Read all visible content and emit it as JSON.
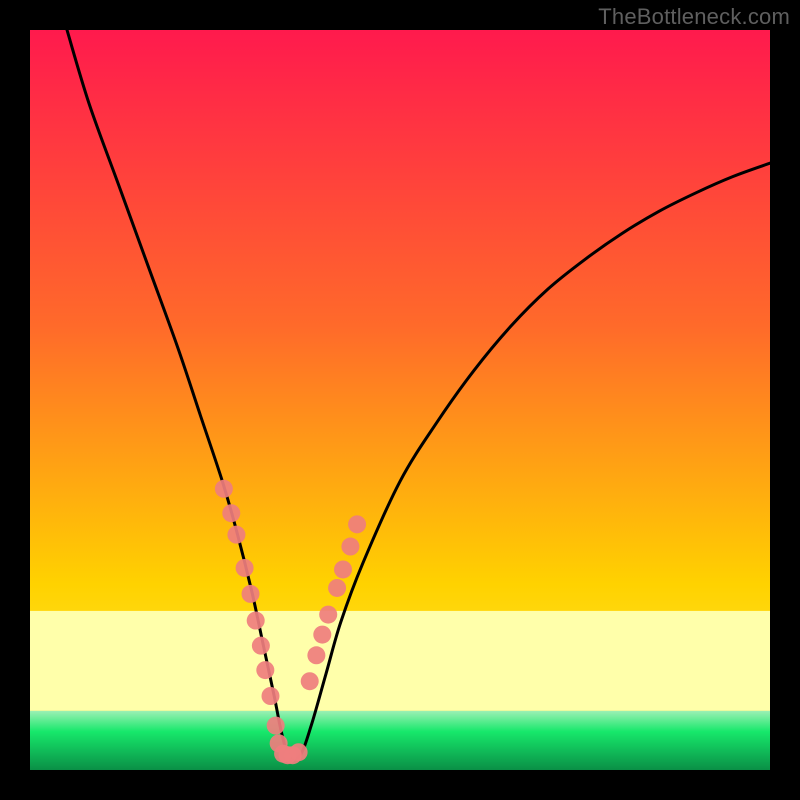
{
  "watermark": "TheBottleneck.com",
  "chart_data": {
    "type": "line",
    "title": "",
    "xlabel": "",
    "ylabel": "",
    "xlim": [
      0,
      100
    ],
    "ylim": [
      0,
      100
    ],
    "series": [
      {
        "name": "bottleneck-curve",
        "x": [
          5,
          8,
          12,
          16,
          20,
          23,
          26,
          28,
          30,
          31.5,
          33,
          34,
          35,
          36.5,
          38,
          40,
          42,
          45,
          50,
          55,
          60,
          65,
          70,
          75,
          80,
          85,
          90,
          95,
          100
        ],
        "y": [
          100,
          90,
          79,
          68,
          57,
          48,
          39,
          32,
          24,
          17,
          10,
          5,
          2,
          2,
          6,
          13,
          20,
          28,
          39,
          47,
          54,
          60,
          65,
          69,
          72.5,
          75.5,
          78,
          80.2,
          82
        ],
        "color": "#000000"
      }
    ],
    "scatter_points": {
      "name": "highlight-dots",
      "color": "#ef7e7e",
      "x": [
        26.2,
        27.2,
        27.9,
        29.0,
        29.8,
        30.5,
        31.2,
        31.8,
        32.5,
        33.2,
        33.6,
        34.2,
        34.8,
        35.5,
        36.3,
        37.8,
        38.7,
        39.5,
        40.3,
        41.5,
        42.3,
        43.3,
        44.2
      ],
      "y": [
        38.0,
        34.7,
        31.8,
        27.3,
        23.8,
        20.2,
        16.8,
        13.5,
        10.0,
        6.0,
        3.6,
        2.2,
        2.0,
        2.0,
        2.4,
        12.0,
        15.5,
        18.3,
        21.0,
        24.6,
        27.1,
        30.2,
        33.2
      ]
    },
    "gradient_bands": {
      "top_color": "#ff1a4d",
      "mid_color": "#ffd200",
      "pale_band_color": "#ffffaa",
      "green_color": "#17e86b",
      "deep_green": "#0fa850",
      "pale_band_top_pct": 78.5,
      "pale_band_bottom_pct": 92.0,
      "green_band_top_pct": 92.0
    }
  }
}
